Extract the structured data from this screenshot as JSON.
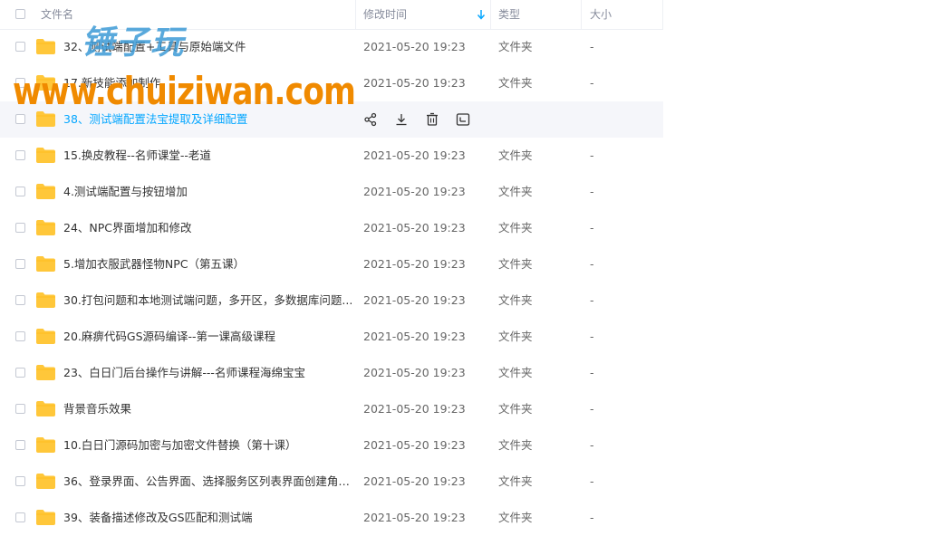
{
  "header": {
    "name_label": "文件名",
    "time_label": "修改时间",
    "type_label": "类型",
    "size_label": "大小",
    "sort_icon": "arrow-down-icon"
  },
  "rows": [
    {
      "name": "32、测试端配置+工具与原始端文件",
      "time": "2021-05-20 19:23",
      "type": "文件夹",
      "size": "-"
    },
    {
      "name": "17.新技能添加制作",
      "time": "2021-05-20 19:23",
      "type": "文件夹",
      "size": "-"
    },
    {
      "name": "38、测试端配置法宝提取及详细配置",
      "time": "",
      "type": "",
      "size": "",
      "hover": true
    },
    {
      "name": "15.换皮教程--名师课堂--老道",
      "time": "2021-05-20 19:23",
      "type": "文件夹",
      "size": "-"
    },
    {
      "name": "4.测试端配置与按钮增加",
      "time": "2021-05-20 19:23",
      "type": "文件夹",
      "size": "-"
    },
    {
      "name": "24、NPC界面增加和修改",
      "time": "2021-05-20 19:23",
      "type": "文件夹",
      "size": "-"
    },
    {
      "name": "5.增加衣服武器怪物NPC（第五课）",
      "time": "2021-05-20 19:23",
      "type": "文件夹",
      "size": "-"
    },
    {
      "name": "30.打包问题和本地测试端问题，多开区，多数据库问题...",
      "time": "2021-05-20 19:23",
      "type": "文件夹",
      "size": "-"
    },
    {
      "name": "20.麻痹代码GS源码编译--第一课高级课程",
      "time": "2021-05-20 19:23",
      "type": "文件夹",
      "size": "-"
    },
    {
      "name": "23、白日门后台操作与讲解---名师课程海绵宝宝",
      "time": "2021-05-20 19:23",
      "type": "文件夹",
      "size": "-"
    },
    {
      "name": "背景音乐效果",
      "time": "2021-05-20 19:23",
      "type": "文件夹",
      "size": "-"
    },
    {
      "name": "10.白日门源码加密与加密文件替换（第十课）",
      "time": "2021-05-20 19:23",
      "type": "文件夹",
      "size": "-"
    },
    {
      "name": "36、登录界面、公告界面、选择服务区列表界面创建角色...",
      "time": "2021-05-20 19:23",
      "type": "文件夹",
      "size": "-"
    },
    {
      "name": "39、装备描述修改及GS匹配和测试端",
      "time": "2021-05-20 19:23",
      "type": "文件夹",
      "size": "-"
    }
  ],
  "hover_actions": [
    {
      "name": "share-icon"
    },
    {
      "name": "download-icon"
    },
    {
      "name": "delete-icon"
    },
    {
      "name": "more-icon"
    }
  ],
  "watermark": {
    "cn": "锤子玩",
    "url": "www.chuiziwan.com"
  },
  "colors": {
    "accent": "#06a7ff",
    "folder": "#ffc73a",
    "watermark_cn": "#3d9bd6",
    "watermark_url": "#f08a00"
  }
}
